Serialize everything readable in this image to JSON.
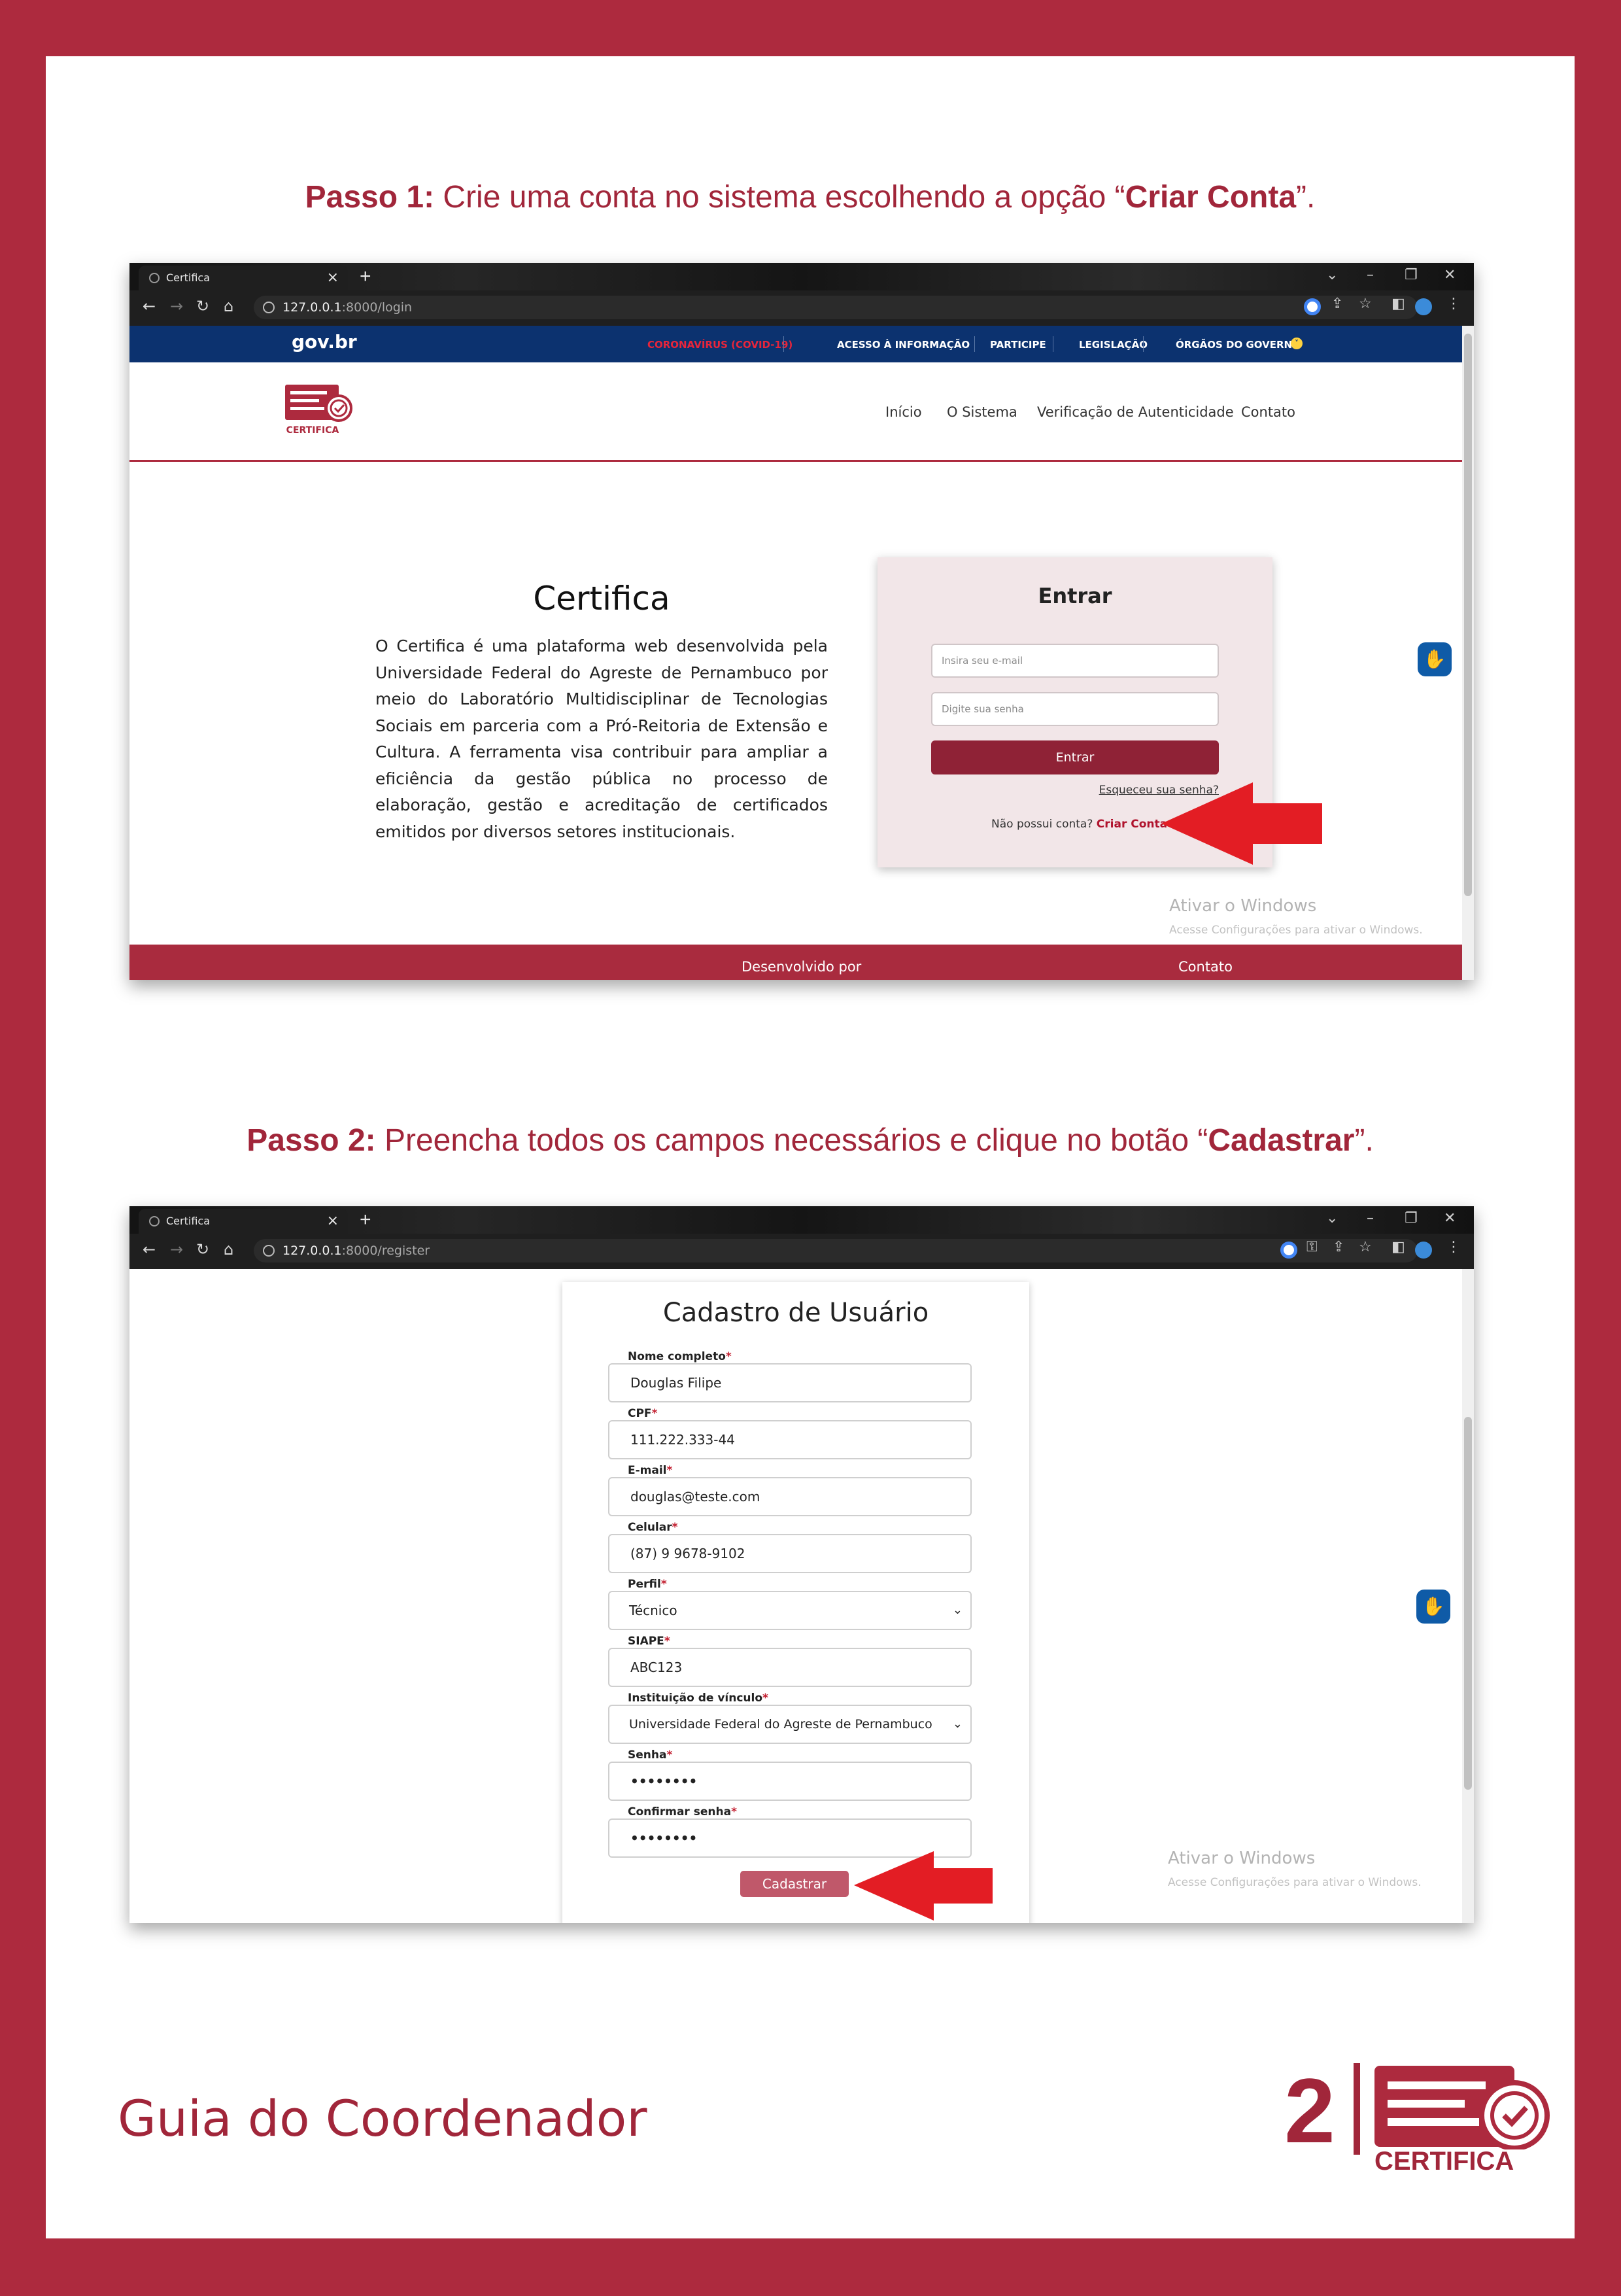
{
  "colors": {
    "brand": "#a1263a",
    "frame": "#ad2a3e",
    "gov_blue": "#0c326f",
    "link_red": "#b0142e"
  },
  "step1": {
    "prefix": "Passo 1:",
    "text": " Crie uma conta no sistema escolhendo a opção “",
    "emphasis": "Criar Conta",
    "suffix": "”."
  },
  "step2": {
    "prefix": "Passo 2:",
    "text": " Preencha todos os campos necessários e clique no botão “",
    "emphasis": "Cadastrar",
    "suffix": "”."
  },
  "screenshot1": {
    "tab_title": "Certifica",
    "url_host": "127.0.0.1",
    "url_path": ":8000/login",
    "gov": {
      "logo": "gov.br",
      "links": [
        "CORONAVÍRUS (COVID-19)",
        "ACESSO À INFORMAÇÃO",
        "PARTICIPE",
        "LEGISLAÇÃO",
        "ÓRGÃOS DO GOVERNO"
      ]
    },
    "site_logo_text": "CERTIFICA",
    "menu": [
      "Início",
      "O Sistema",
      "Verificação de Autenticidade",
      "Contato"
    ],
    "hero_title": "Certifica",
    "hero_text": "O Certifica é uma plataforma web desenvolvida pela Universidade Federal do Agreste de Pernambuco por meio do Laboratório Multidisciplinar de Tecnologias Sociais em parceria com a Pró-Reitoria de Extensão e Cultura. A ferramenta visa contribuir para ampliar a eficiência da gestão pública no processo de elaboração, gestão e acreditação de certificados emitidos por diversos setores institucionais.",
    "login": {
      "title": "Entrar",
      "email_placeholder": "Insira seu e-mail",
      "password_placeholder": "Digite sua senha",
      "button": "Entrar",
      "forgot": "Esqueceu sua senha?",
      "no_account": "Não possui conta? ",
      "create_account": "Criar Conta"
    },
    "watermark": {
      "title": "Ativar o Windows",
      "subtitle": "Acesse Configurações para ativar o Windows."
    },
    "footer": {
      "left": "Desenvolvido por",
      "right": "Contato"
    }
  },
  "screenshot2": {
    "tab_title": "Certifica",
    "url_host": "127.0.0.1",
    "url_path": ":8000/register",
    "form_title": "Cadastro de Usuário",
    "fields": [
      {
        "label": "Nome completo",
        "value": "Douglas Filipe",
        "type": "text"
      },
      {
        "label": "CPF",
        "value": "111.222.333-44",
        "type": "text"
      },
      {
        "label": "E-mail",
        "value": "douglas@teste.com",
        "type": "text"
      },
      {
        "label": "Celular",
        "value": "(87) 9 9678-9102",
        "type": "text"
      },
      {
        "label": "Perfil",
        "value": "Técnico",
        "type": "select"
      },
      {
        "label": "SIAPE",
        "value": "ABC123",
        "type": "text"
      },
      {
        "label": "Instituição de vínculo",
        "value": "Universidade Federal do Agreste de Pernambuco",
        "type": "select"
      },
      {
        "label": "Senha",
        "value": "••••••••",
        "type": "password"
      },
      {
        "label": "Confirmar senha",
        "value": "••••••••",
        "type": "password"
      }
    ],
    "required_mark": "*",
    "submit": "Cadastrar",
    "watermark": {
      "title": "Ativar o Windows",
      "subtitle": "Acesse Configurações para ativar o Windows."
    }
  },
  "footer": {
    "guide_title": "Guia do Coordenador",
    "page_number": "2",
    "logo_text": "CERTIFICA"
  }
}
